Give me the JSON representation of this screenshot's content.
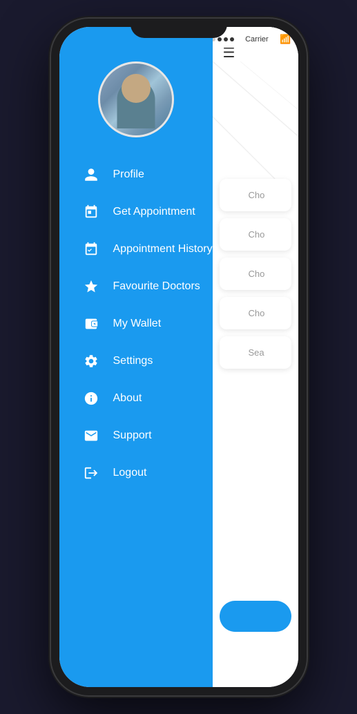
{
  "phone": {
    "status_bar": {
      "carrier": "Carrier",
      "signal_dots": [
        false,
        false,
        true,
        true,
        true
      ],
      "wifi_icon": "wifi"
    }
  },
  "sidebar": {
    "menu_items": [
      {
        "id": "profile",
        "label": "Profile",
        "icon": "person"
      },
      {
        "id": "get-appointment",
        "label": "Get Appointment",
        "icon": "calendar"
      },
      {
        "id": "appointment-history",
        "label": "Appointment History",
        "icon": "calendar-check"
      },
      {
        "id": "favourite-doctors",
        "label": "Favourite Doctors",
        "icon": "star"
      },
      {
        "id": "my-wallet",
        "label": "My Wallet",
        "icon": "wallet"
      },
      {
        "id": "settings",
        "label": "Settings",
        "icon": "gear"
      },
      {
        "id": "about",
        "label": "About",
        "icon": "info"
      },
      {
        "id": "support",
        "label": "Support",
        "icon": "envelope"
      },
      {
        "id": "logout",
        "label": "Logout",
        "icon": "logout"
      }
    ]
  },
  "right_panel": {
    "hamburger": "☰",
    "search_items": [
      {
        "icon": "📍",
        "text": "Cho"
      },
      {
        "icon": "📍",
        "text": "Cho"
      },
      {
        "icon": "📍",
        "text": "Cho"
      },
      {
        "icon": "🏥",
        "text": "Cho"
      },
      {
        "icon": "👨‍⚕️",
        "text": "Sea"
      }
    ]
  }
}
